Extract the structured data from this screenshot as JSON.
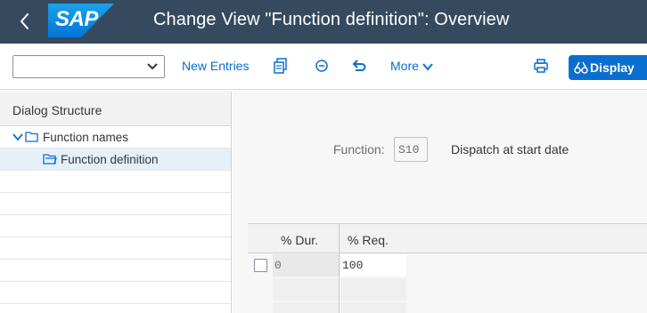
{
  "shell": {
    "logo_text": "SAP",
    "title": "Change View \"Function definition\": Overview"
  },
  "toolbar": {
    "dropdown_value": "",
    "new_entries_label": "New Entries",
    "more_label": "More",
    "display_label": "Display"
  },
  "dialog_structure": {
    "header": "Dialog Structure",
    "items": [
      {
        "label": "Function names"
      },
      {
        "label": "Function definition"
      }
    ]
  },
  "function": {
    "label": "Function:",
    "value": "S10",
    "description": "Dispatch at start date"
  },
  "table": {
    "columns": [
      "% Dur.",
      "% Req."
    ],
    "rows": [
      {
        "dur": "0",
        "req": "100"
      }
    ]
  },
  "colors": {
    "shell_bg": "#354a5f",
    "accent": "#0a6ed1",
    "content_bg": "#f7f7f7"
  }
}
